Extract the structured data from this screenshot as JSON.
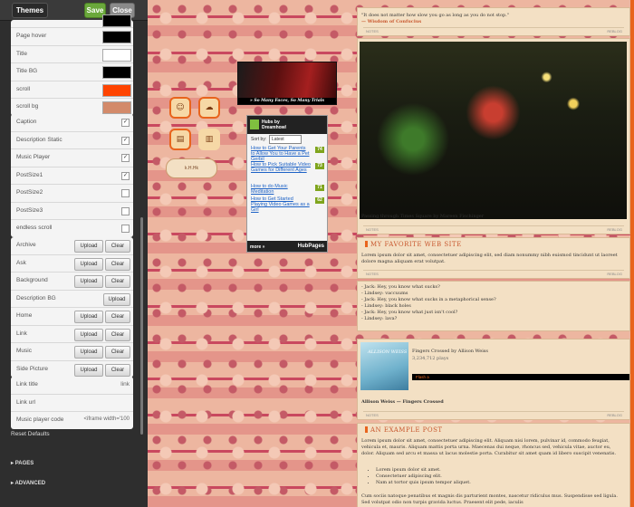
{
  "toolbar": {
    "themes": "Themes",
    "save": "Save",
    "close": "Close"
  },
  "appearance": [
    {
      "label": "Page hover",
      "color": "#000000"
    },
    {
      "label": "Title",
      "color": "#ffffff"
    },
    {
      "label": "Title BG",
      "color": "#000000"
    },
    {
      "label": "scroll",
      "color": "#ff4400"
    },
    {
      "label": "scroll bg",
      "color": "#d38a6a"
    }
  ],
  "options": [
    {
      "label": "Caption",
      "checked": true
    },
    {
      "label": "Description Static",
      "checked": true
    },
    {
      "label": "Music Player",
      "checked": true
    },
    {
      "label": "PostSize1",
      "checked": true
    },
    {
      "label": "PostSize2",
      "checked": false
    },
    {
      "label": "PostSize3",
      "checked": false
    },
    {
      "label": "endless scroll",
      "checked": false
    }
  ],
  "images": [
    {
      "label": "Archive",
      "upload": "Upload",
      "clear": "Clear"
    },
    {
      "label": "Ask",
      "upload": "Upload",
      "clear": "Clear"
    },
    {
      "label": "Background",
      "upload": "Upload",
      "clear": "Clear"
    },
    {
      "label": "Description BG",
      "upload": "Upload",
      "clear": ""
    },
    {
      "label": "Home",
      "upload": "Upload",
      "clear": "Clear"
    },
    {
      "label": "Link",
      "upload": "Upload",
      "clear": "Clear"
    },
    {
      "label": "Music",
      "upload": "Upload",
      "clear": "Clear"
    },
    {
      "label": "Side Picture",
      "upload": "Upload",
      "clear": "Clear"
    }
  ],
  "texts": [
    {
      "label": "Link title",
      "value": "link"
    },
    {
      "label": "Link url",
      "value": ""
    },
    {
      "label": "Music player code",
      "value": "<iframe width='100"
    }
  ],
  "reset_defaults": "Reset Defaults",
  "sections": [
    "PAGES",
    "ADVANCED"
  ],
  "blog": {
    "header_caption": "» So Many Faces, So Many Trials",
    "pill": "k.H.Hk",
    "hubpages": {
      "brand": "Hubs by",
      "user": "Dreamhowl",
      "sort_label": "Sort by:",
      "sort_value": "Latest",
      "items": [
        {
          "title": "How to Get Your Parents to Allow You to Have a Pet Gerbil",
          "score": "74"
        },
        {
          "title": "How to Pick Suitable Video Games for Different Ages",
          "score": "73"
        },
        {
          "title": "How to do Music Meditation",
          "score": "71"
        },
        {
          "title": "How to Get Started Playing Video Games as a Girl",
          "score": "62"
        }
      ],
      "more": "more »",
      "logo": "HubPages"
    },
    "quote": {
      "text": "\"It does not matter how slow you go as long as you do not stop.\"",
      "by": "— Wisdom of Confucius"
    },
    "notes": "NOTES",
    "reblog": "REBLOG",
    "photo_caption": "Passing through Times Square by Mareen Fischinger",
    "text_post": {
      "title": "MY FAVORITE WEB SITE",
      "body": "Lorem ipsum dolor sit amet, consectetuer adipiscing elit, sed diam nonummy nibh euismod tincidunt ut laoreet dolore magna aliquam erat volutpat."
    },
    "chat": [
      "- Jack: Hey, you know what sucks?",
      "- Lindsey: vaccuums",
      "- Jack: Hey, you know what sucks in a metaphorical sense?",
      "- Lindsey: black holes",
      "- Jack: Hey, you know what just isn't cool?",
      "- Lindsey: lava?"
    ],
    "music": {
      "cover": "ALLISON WEISS",
      "title": "Fingers Crossed by Allison Weiss",
      "plays": "3,234,712 plays",
      "flash": "Flash a",
      "caption": "Allison Weiss — Fingers Crossed"
    },
    "example_post": {
      "title": "AN EXAMPLE POST",
      "body": "Lorem ipsum dolor sit amet, consectetuer adipiscing elit. Aliquam nisi lorem, pulvinar id, commodo feugiat, vehicula et, mauris. Aliquam mattis porta urna. Maecenas dui neque, rhoncus sed, vehicula vitae, auctor eu, dolor. Aliquam sed arcu et massa ut lacus molestie porta. Curabitur sit amet quam id libero suscipit venenatis.",
      "bullets": [
        "Lorem ipsum dolor sit amet.",
        "Consectetuer adipiscing elit.",
        "Nam at tortor quis ipsum tempor aliquet."
      ],
      "tail": "Cum sociis natoque penatibus et magnis dis parturient montes, nascetur ridiculus mus. Suspendisse sed ligula. Sed volutpat odio non turpis gravida luctus. Praesent elit pede, iaculis"
    }
  }
}
